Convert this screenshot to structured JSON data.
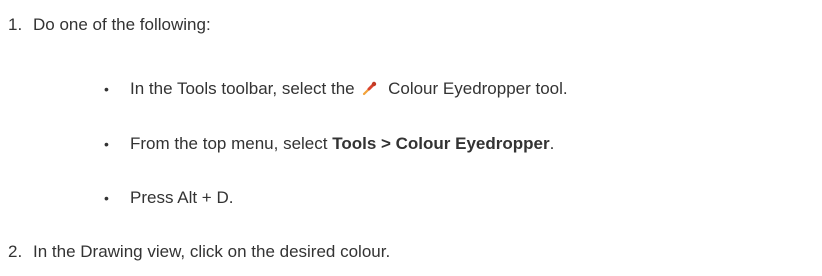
{
  "steps": [
    {
      "number": "1.",
      "text": "Do one of the following:",
      "options": [
        {
          "before_icon": "In the Tools toolbar, select the",
          "icon": "eyedropper-icon",
          "after_icon": "Colour Eyedropper tool."
        },
        {
          "text_before": "From the top menu, select ",
          "bold": "Tools > Colour Eyedropper",
          "text_after": "."
        },
        {
          "text": "Press Alt + D."
        }
      ]
    },
    {
      "number": "2.",
      "text": "In the Drawing view, click on the desired colour."
    }
  ],
  "colors": {
    "text": "#333333",
    "icon_tip": "#f2a23a",
    "icon_body": "#d9452e"
  }
}
